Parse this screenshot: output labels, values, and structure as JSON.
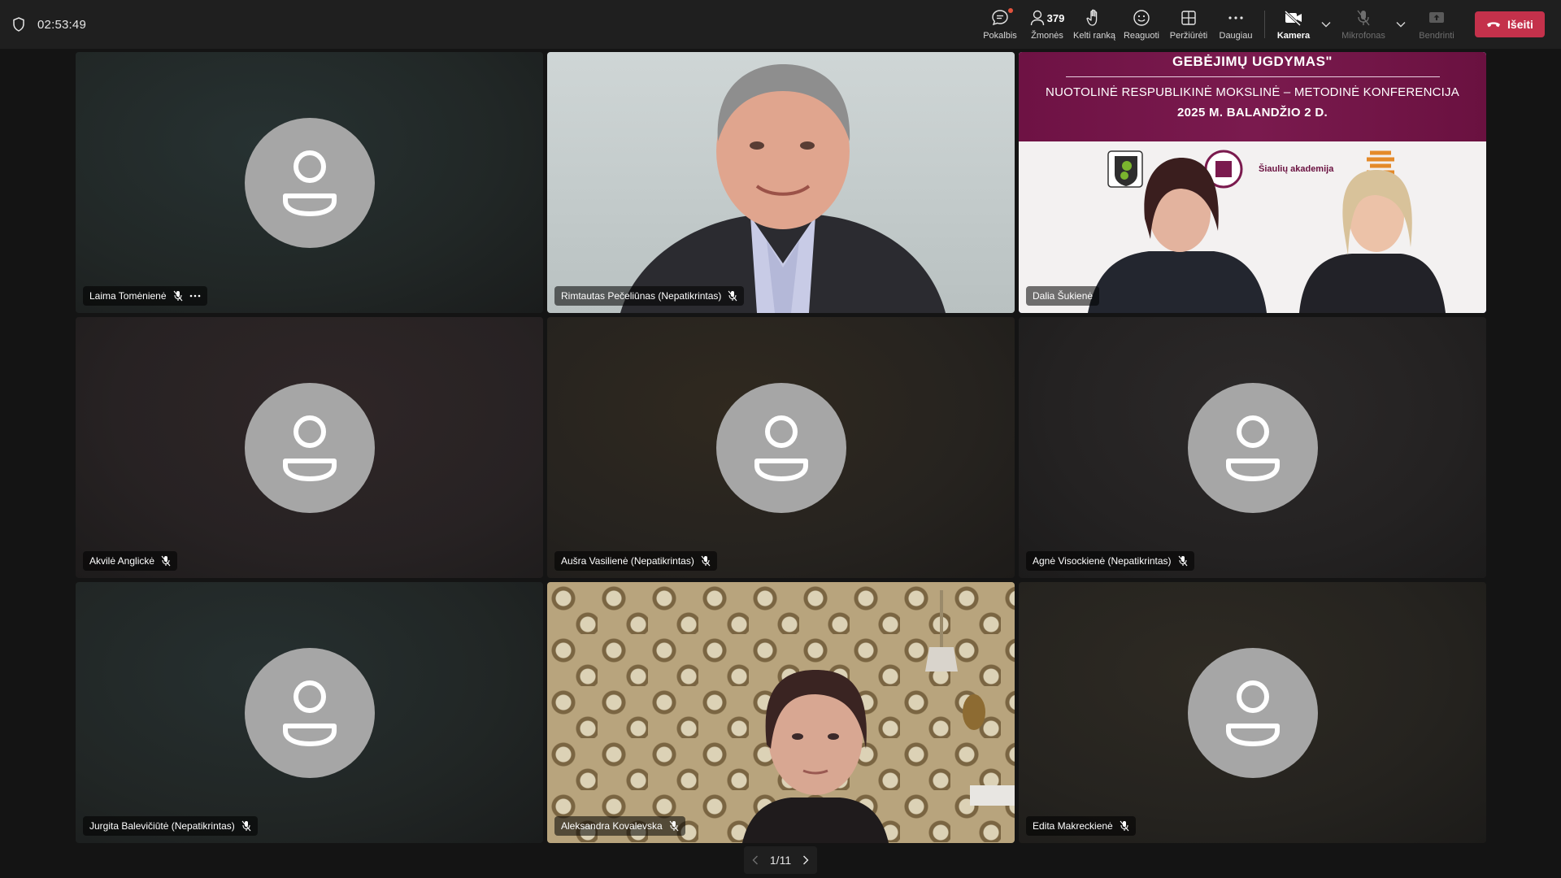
{
  "meeting": {
    "elapsed_time": "02:53:49"
  },
  "toolbar": {
    "chat_label": "Pokalbis",
    "people_label": "Žmonės",
    "people_count": "379",
    "raise_hand_label": "Kelti ranką",
    "react_label": "Reaguoti",
    "view_label": "Peržiūrėti",
    "more_label": "Daugiau",
    "camera_label": "Kamera",
    "mic_label": "Mikrofonas",
    "share_label": "Bendrinti",
    "leave_label": "Išeiti",
    "leave_color": "#c4314b"
  },
  "participants": [
    {
      "name": "Laima Tomėnienė",
      "mic": "muted",
      "has_more": true
    },
    {
      "name": "Rimtautas Pečeliūnas (Nepatikrintas)",
      "mic": "muted",
      "video": true
    },
    {
      "name": "Dalia Šukienė",
      "speaking": true,
      "video": true
    },
    {
      "name": "Akvilė Anglickė",
      "mic": "muted"
    },
    {
      "name": "Aušra Vasilienė (Nepatikrintas)",
      "mic": "muted"
    },
    {
      "name": "Agnė Visockienė (Nepatikrintas)",
      "mic": "muted"
    },
    {
      "name": "Jurgita Balevičiūtė (Nepatikrintas)",
      "mic": "muted"
    },
    {
      "name": "Aleksandra Kovalevska",
      "mic": "muted",
      "video": true
    },
    {
      "name": "Edita Makreckienė",
      "mic": "muted"
    }
  ],
  "shared_slide": {
    "title": "GEBĖJIMŲ UGDYMAS\"",
    "subtitle": "NUOTOLINĖ RESPUBLIKINĖ MOKSLINĖ – METODINĖ KONFERENCIJA",
    "date": "2025 M. BALANDŽIO 2 D.",
    "logo_text": "Šiaulių akademija"
  },
  "pager": {
    "label": "1/11"
  },
  "colors": {
    "speaking_outline": "#8f8cf0",
    "avatar": "#a6a6a6",
    "topbar": "#1f1f1f"
  }
}
